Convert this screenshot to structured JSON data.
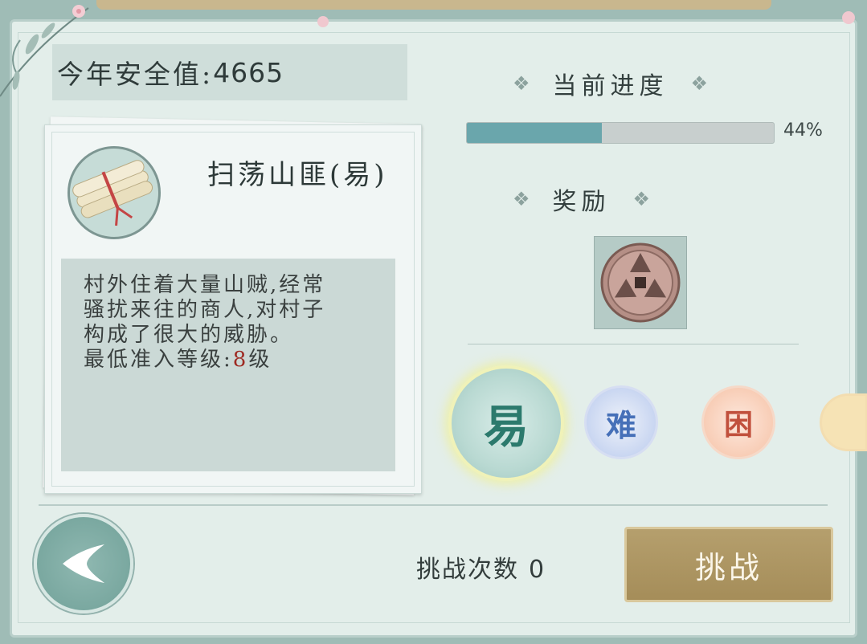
{
  "safety": {
    "label": "今年安全值:",
    "value": "4665"
  },
  "quest": {
    "title": "扫荡山匪(易)",
    "description_lines": [
      "村外住着大量山贼,经常",
      "骚扰来往的商人,对村子",
      "构成了很大的威胁。"
    ],
    "min_level_label": "最低准入等级:",
    "min_level_value": "8",
    "min_level_unit": "级"
  },
  "progress": {
    "heading": "当前进度",
    "percent_text": "44%",
    "fraction": 0.44
  },
  "reward": {
    "heading": "奖励",
    "item_icon": "coin-icon"
  },
  "difficulties": [
    {
      "label": "易",
      "selected": true
    },
    {
      "label": "难",
      "selected": false
    },
    {
      "label": "困",
      "selected": false
    }
  ],
  "footer": {
    "challenge_count_label": "挑战次数",
    "challenge_count": "0",
    "challenge_button": "挑战"
  },
  "colors": {
    "accent_teal": "#6aa6ac",
    "button_gold": "#a58d59",
    "level_red": "#9e2a22"
  }
}
